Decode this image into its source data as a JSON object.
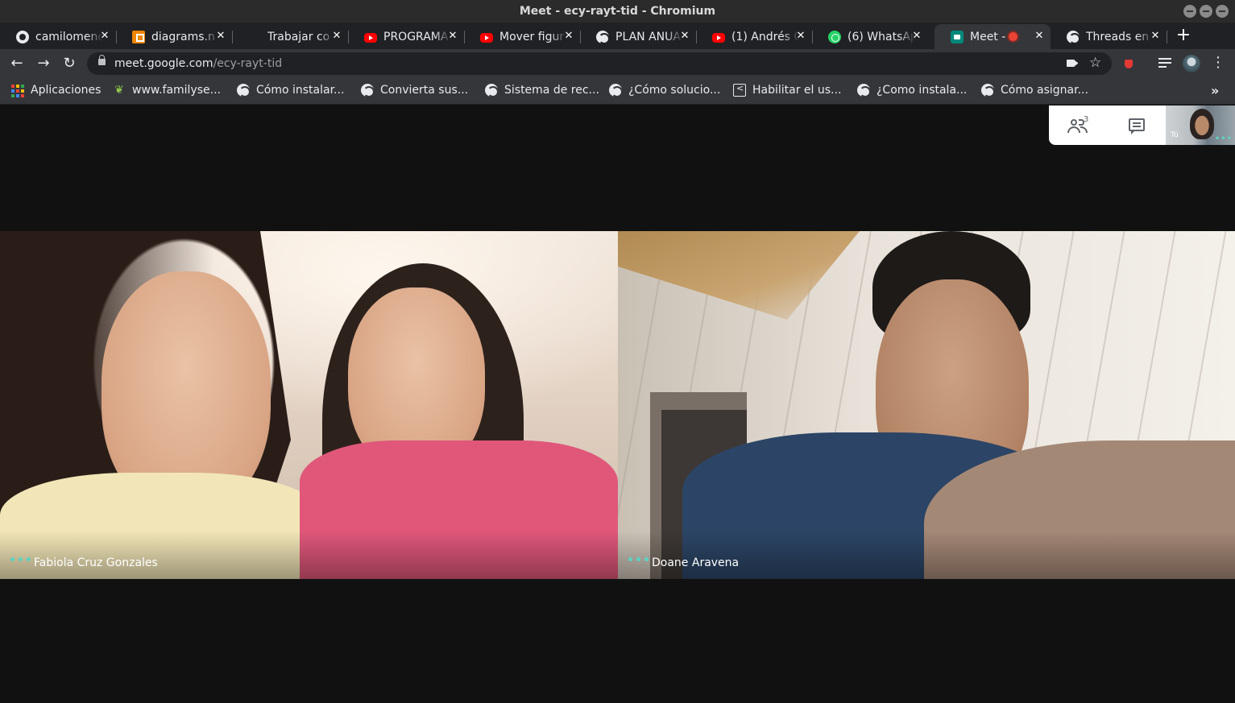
{
  "window": {
    "title": "Meet - ecy-rayt-tid - Chromium"
  },
  "tabs": [
    {
      "label": "camilomenc",
      "icon": "github-icon"
    },
    {
      "label": "diagrams.n",
      "icon": "drawio-icon"
    },
    {
      "label": "Trabajar co",
      "icon": "none"
    },
    {
      "label": "PROGRAMA",
      "icon": "youtube-icon"
    },
    {
      "label": "Mover figur",
      "icon": "youtube-icon"
    },
    {
      "label": "PLAN ANUA",
      "icon": "globe-icon"
    },
    {
      "label": "(1) Andrés C",
      "icon": "youtube-icon"
    },
    {
      "label": "(6) WhatsAp",
      "icon": "whatsapp-icon"
    },
    {
      "label": "Meet - ec",
      "icon": "meet-icon",
      "active": true,
      "recording": true
    },
    {
      "label": "Threads en",
      "icon": "globe-icon"
    }
  ],
  "toolbar": {
    "url_host": "meet.google.com",
    "url_path": "/ecy-rayt-tid"
  },
  "bookmarks": [
    {
      "label": "Aplicaciones",
      "icon": "apps-grid-icon"
    },
    {
      "label": "www.familyse...",
      "icon": "leaf-icon"
    },
    {
      "label": "Cómo instalar...",
      "icon": "globe-icon"
    },
    {
      "label": "Convierta sus...",
      "icon": "globe-icon"
    },
    {
      "label": "Sistema de rec...",
      "icon": "globe-icon"
    },
    {
      "label": "¿Cómo solucio...",
      "icon": "globe-icon"
    },
    {
      "label": "Habilitar el us...",
      "icon": "share-icon"
    },
    {
      "label": "¿Como instala...",
      "icon": "globe-icon"
    },
    {
      "label": "Cómo asignar...",
      "icon": "globe-icon"
    }
  ],
  "meet": {
    "participant_count": "3",
    "self_label": "Tú",
    "tiles": [
      {
        "name": "Fabiola Cruz Gonzales"
      },
      {
        "name": "Doane Aravena"
      }
    ]
  },
  "colors": {
    "titlebar": "#2b2b2b",
    "tabstrip": "#202124",
    "toolbar": "#35363a",
    "meet_bg": "#111111",
    "accent_teal": "#5bd3c1",
    "record_red": "#ea4335"
  }
}
